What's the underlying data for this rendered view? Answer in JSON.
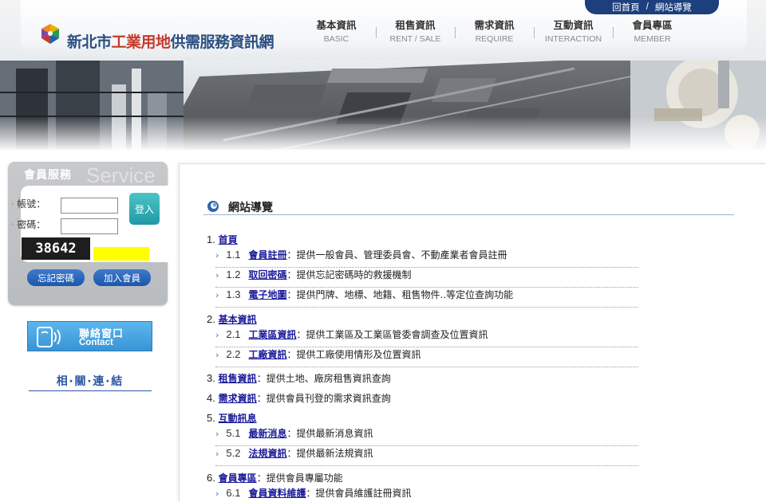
{
  "header": {
    "top_links": [
      "回首頁",
      "/",
      "網站導覽"
    ],
    "title_part1": "新北市",
    "title_part2": "工業用地",
    "title_part3": "供需服務資訊網",
    "nav": [
      {
        "zh": "基本資訊",
        "en": "BASIC"
      },
      {
        "zh": "租售資訊",
        "en": "RENT / SALE"
      },
      {
        "zh": "需求資訊",
        "en": "REQUIRE"
      },
      {
        "zh": "互動資訊",
        "en": "INTERACTION"
      },
      {
        "zh": "會員專區",
        "en": "MEMBER"
      }
    ]
  },
  "sidebar": {
    "login_title": "會員服務",
    "login_watermark": "Service",
    "account_label": "帳號：",
    "password_label": "密碼：",
    "login_button": "登入",
    "captcha": "38642",
    "forgot_password": "忘記密碼",
    "join_member": "加入會員",
    "contact_zh": "聯絡窗口",
    "contact_en": "Contact",
    "related_links": "相‧關‧連‧結"
  },
  "main": {
    "section_title": "網站導覽",
    "sitemap": [
      {
        "num": "1.",
        "label": "首頁",
        "desc": "",
        "children": [
          {
            "num": "1.1",
            "label": "會員註冊",
            "desc": "：提供一般會員、管理委員會、不動產業者會員註冊"
          },
          {
            "num": "1.2",
            "label": "取回密碼",
            "desc": "：提供忘記密碼時的救援機制"
          },
          {
            "num": "1.3",
            "label": "電子地圖",
            "desc": "：提供門牌、地標、地籍、租售物件..等定位查詢功能"
          }
        ]
      },
      {
        "num": "2.",
        "label": "基本資訊",
        "desc": "",
        "children": [
          {
            "num": "2.1",
            "label": "工業區資訊",
            "desc": "：提供工業區及工業區管委會調查及位置資訊"
          },
          {
            "num": "2.2",
            "label": "工廠資訊",
            "desc": "：提供工廠使用情形及位置資訊"
          }
        ]
      },
      {
        "num": "3.",
        "label": "租售資訊",
        "desc": "：提供土地、廠房租售資訊查詢",
        "children": []
      },
      {
        "num": "4.",
        "label": "需求資訊",
        "desc": "：提供會員刊登的需求資訊查詢",
        "children": []
      },
      {
        "num": "5.",
        "label": "互動訊息",
        "desc": "",
        "children": [
          {
            "num": "5.1",
            "label": "最新消息",
            "desc": "：提供最新消息資訊"
          },
          {
            "num": "5.2",
            "label": "法規資訊",
            "desc": "：提供最新法規資訊"
          }
        ]
      },
      {
        "num": "6.",
        "label": "會員專區",
        "desc": "：提供會員專屬功能",
        "children": [
          {
            "num": "6.1",
            "label": "會員資料維護",
            "desc": "：提供會員維護註冊資訊"
          }
        ]
      }
    ]
  }
}
